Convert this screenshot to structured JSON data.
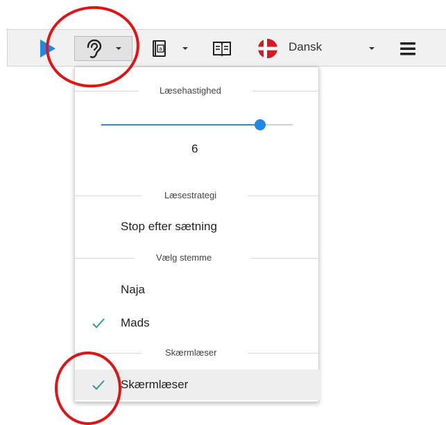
{
  "toolbar": {
    "language_label": "Dansk"
  },
  "dropdown": {
    "reading_speed": {
      "heading": "Læsehastighed",
      "value": "6",
      "slider_fraction": 0.83
    },
    "reading_strategy": {
      "heading": "Læsestrategi",
      "option": "Stop efter sætning"
    },
    "voice": {
      "heading": "Vælg stemme",
      "options": [
        {
          "label": "Naja",
          "checked": false
        },
        {
          "label": "Mads",
          "checked": true
        }
      ]
    },
    "screen_reader": {
      "heading": "Skærmlæser",
      "option": {
        "label": "Skærmlæser",
        "checked": true
      }
    }
  },
  "colors": {
    "accent_blue": "#1e88e5",
    "check_teal": "#2a9d8f",
    "annotation_red": "#e01414",
    "flag_red": "#d71920"
  },
  "icons": [
    "play-icon",
    "ear-icon",
    "dictionary-icon",
    "book-icon",
    "danish-flag-icon",
    "hamburger-menu-icon",
    "checkmark-icon"
  ]
}
